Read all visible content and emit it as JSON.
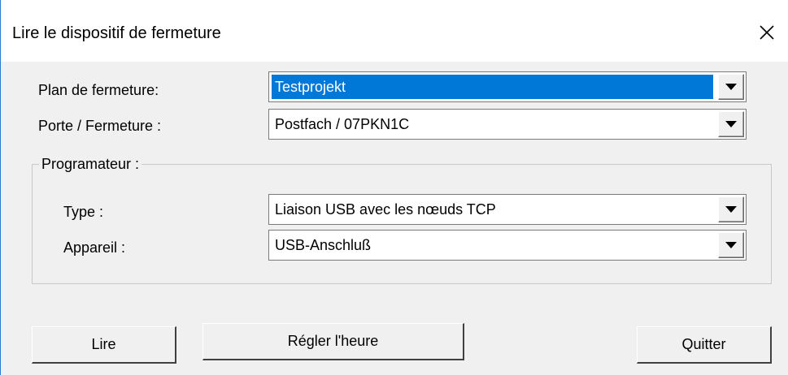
{
  "window": {
    "title": "Lire le dispositif de fermeture",
    "close_icon": "close-icon"
  },
  "form": {
    "plan_label": "Plan de fermeture:",
    "plan_value": "Testprojekt",
    "door_label": "Porte / Fermeture :",
    "door_value": "Postfach / 07PKN1C"
  },
  "programmer": {
    "legend": "Programateur :",
    "type_label": "Type :",
    "type_value": "Liaison USB avec les nœuds TCP",
    "device_label": "Appareil :",
    "device_value": "USB-Anschluß"
  },
  "buttons": {
    "read": "Lire",
    "set_time": "Régler l'heure",
    "quit": "Quitter"
  },
  "colors": {
    "selection": "#0078d7",
    "window_border": "#2b79d7",
    "dialog_bg": "#f0f0f0"
  }
}
